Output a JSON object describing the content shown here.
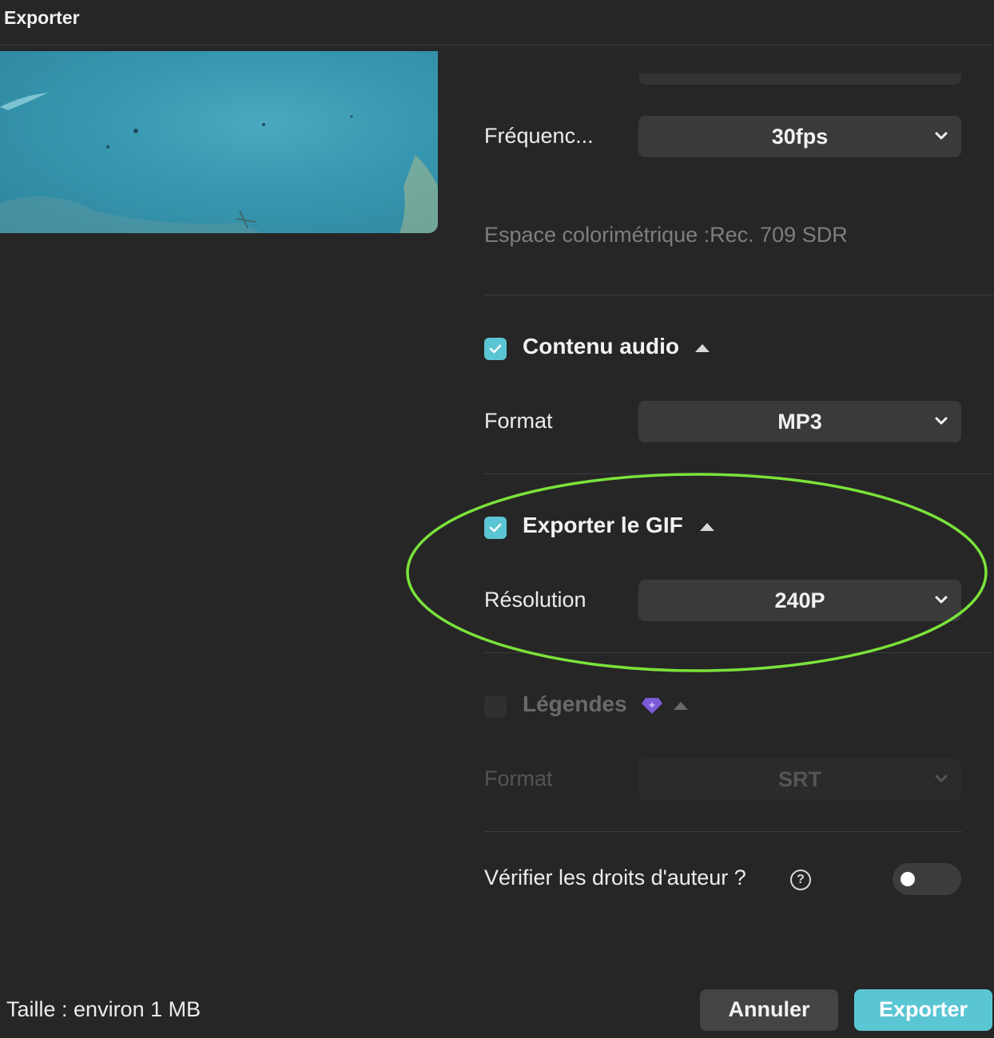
{
  "window": {
    "title": "Exporter"
  },
  "video_settings": {
    "frame_rate_label": "Fréquenc...",
    "frame_rate_value": "30fps",
    "color_space_text": "Espace colorimétrique :Rec. 709 SDR"
  },
  "audio": {
    "checked": true,
    "title": "Contenu audio",
    "format_label": "Format",
    "format_value": "MP3"
  },
  "gif": {
    "checked": true,
    "title": "Exporter le GIF",
    "resolution_label": "Résolution",
    "resolution_value": "240P"
  },
  "captions": {
    "checked": false,
    "title": "Légendes",
    "format_label": "Format",
    "format_value": "SRT"
  },
  "copyright": {
    "label": "Vérifier les droits d'auteur ?",
    "help_symbol": "?",
    "enabled": false
  },
  "footer": {
    "size_text": "Taille : environ 1 MB",
    "cancel_label": "Annuler",
    "export_label": "Exporter"
  },
  "colors": {
    "accent": "#5bc6d3",
    "highlight_ellipse": "#7be23a",
    "premium_gem": "#7b5cd6",
    "background": "#262626"
  },
  "icons": [
    "chevron-down-icon",
    "checkmark-icon",
    "caret-up-icon",
    "premium-gem-icon",
    "help-icon"
  ]
}
